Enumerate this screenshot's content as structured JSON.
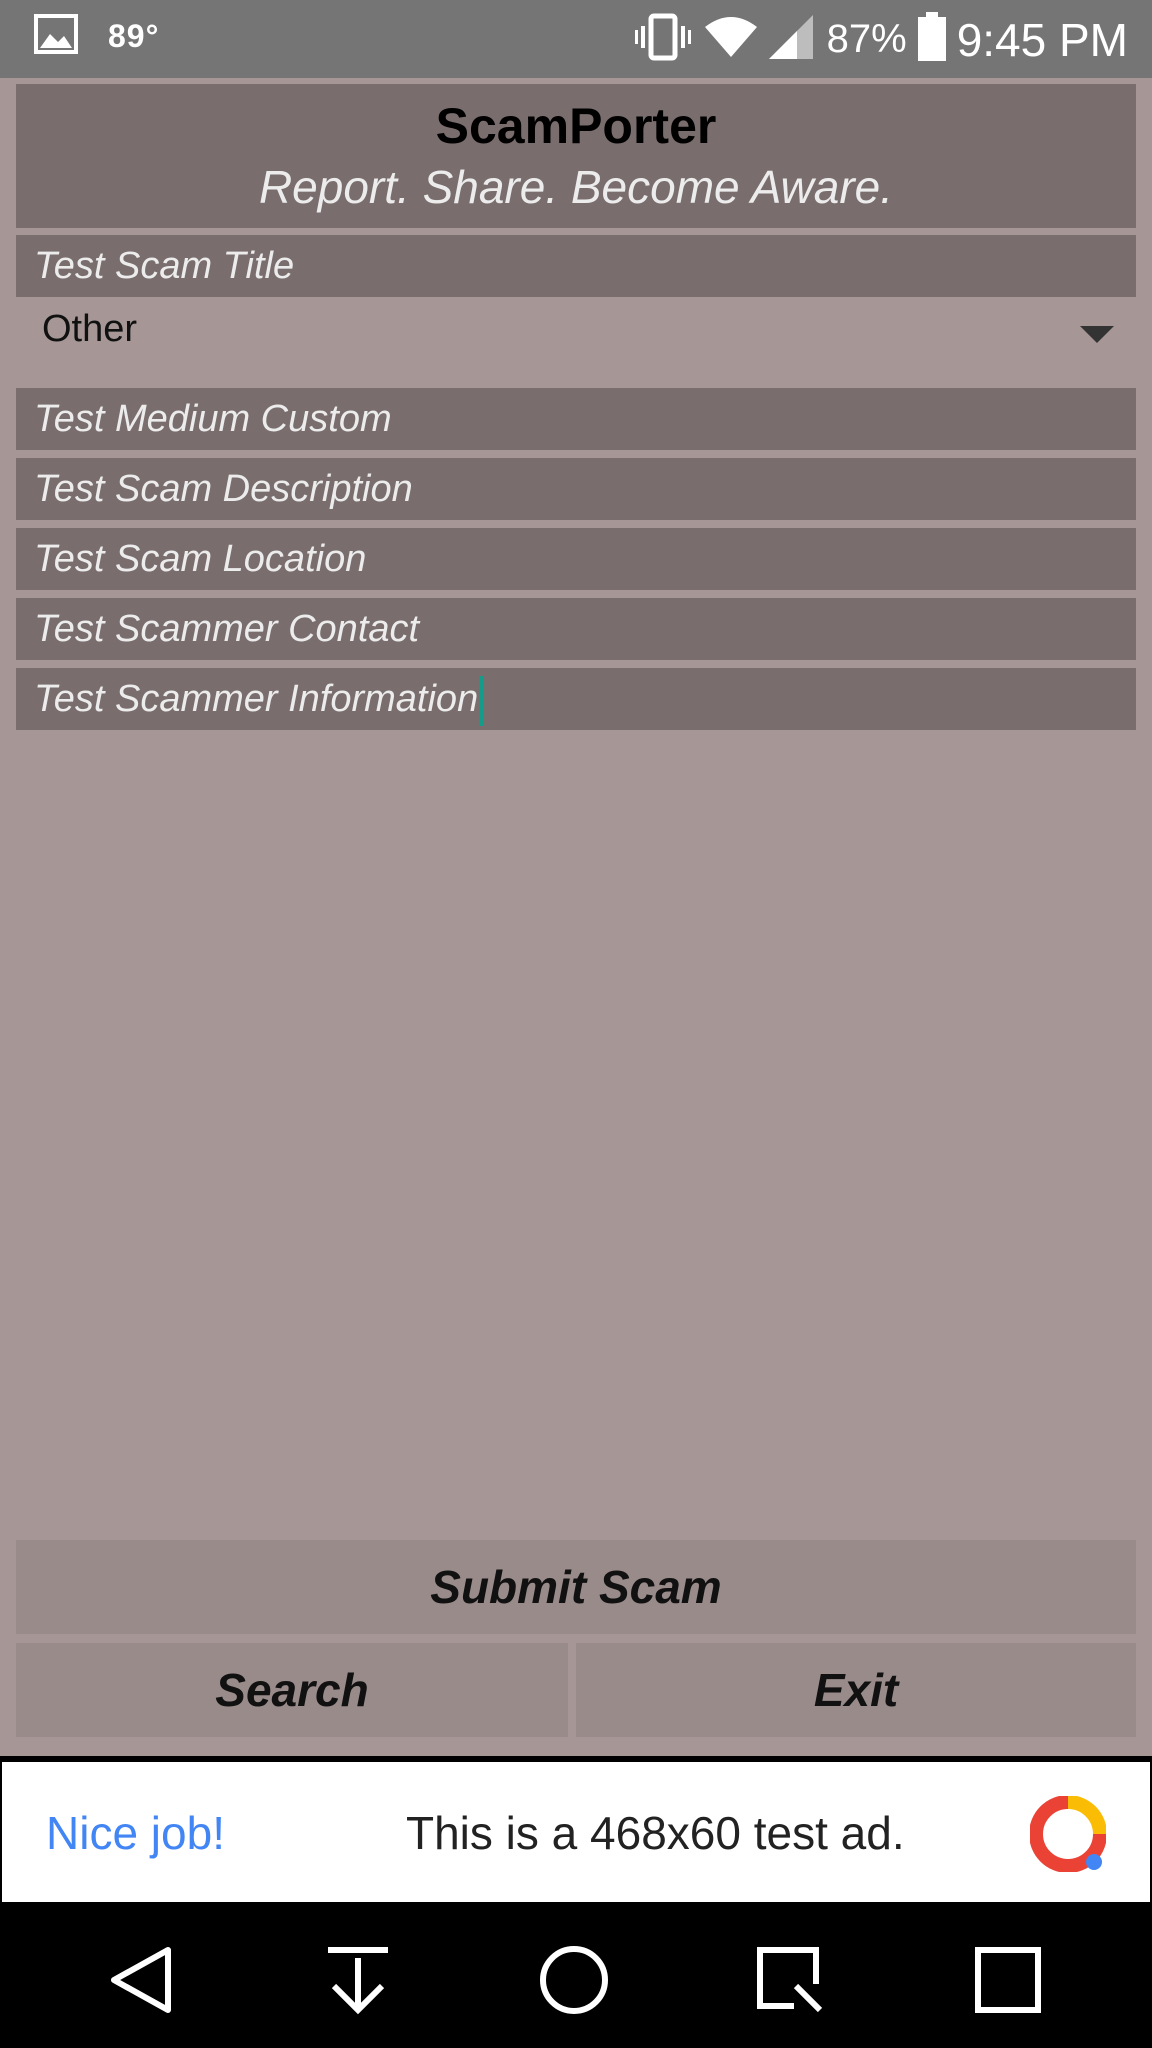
{
  "status_bar": {
    "temperature": "89°",
    "battery": "87%",
    "time": "9:45 PM",
    "icons": [
      "gallery-icon",
      "vibrate-icon",
      "wifi-icon",
      "signal-icon",
      "battery-icon"
    ]
  },
  "header": {
    "title": "ScamPorter",
    "subtitle": "Report. Share. Become Aware."
  },
  "form": {
    "scam_title": "Test Scam Title",
    "medium_select": "Other",
    "medium_custom": "Test Medium Custom",
    "description": "Test Scam Description",
    "location": "Test Scam Location",
    "scammer_contact": "Test Scammer Contact",
    "scammer_information": "Test Scammer Information"
  },
  "actions": {
    "submit": "Submit Scam",
    "search": "Search",
    "exit": "Exit"
  },
  "ad": {
    "nice": "Nice job!",
    "text": "This is a 468x60 test ad."
  },
  "navbar": {
    "icons": [
      "back-icon",
      "download-icon",
      "home-icon",
      "screenshot-icon",
      "recents-icon"
    ]
  },
  "colors": {
    "background": "#a69796",
    "field": "#7a6d6d",
    "button": "#9a8b8b",
    "caret": "#149b8a",
    "ad_accent": "#4285f4"
  }
}
